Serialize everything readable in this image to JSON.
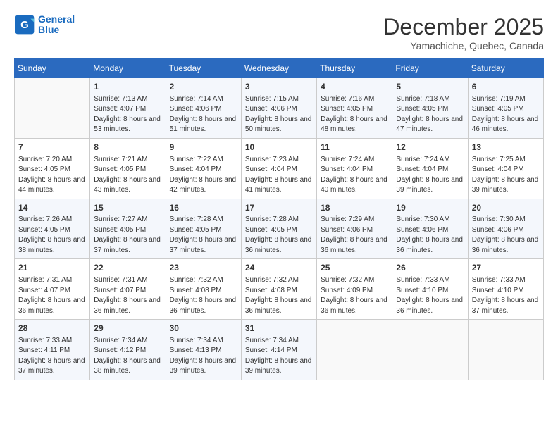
{
  "logo": {
    "line1": "General",
    "line2": "Blue"
  },
  "title": "December 2025",
  "subtitle": "Yamachiche, Quebec, Canada",
  "weekdays": [
    "Sunday",
    "Monday",
    "Tuesday",
    "Wednesday",
    "Thursday",
    "Friday",
    "Saturday"
  ],
  "weeks": [
    [
      {
        "day": "",
        "sunrise": "",
        "sunset": "",
        "daylight": ""
      },
      {
        "day": "1",
        "sunrise": "Sunrise: 7:13 AM",
        "sunset": "Sunset: 4:07 PM",
        "daylight": "Daylight: 8 hours and 53 minutes."
      },
      {
        "day": "2",
        "sunrise": "Sunrise: 7:14 AM",
        "sunset": "Sunset: 4:06 PM",
        "daylight": "Daylight: 8 hours and 51 minutes."
      },
      {
        "day": "3",
        "sunrise": "Sunrise: 7:15 AM",
        "sunset": "Sunset: 4:06 PM",
        "daylight": "Daylight: 8 hours and 50 minutes."
      },
      {
        "day": "4",
        "sunrise": "Sunrise: 7:16 AM",
        "sunset": "Sunset: 4:05 PM",
        "daylight": "Daylight: 8 hours and 48 minutes."
      },
      {
        "day": "5",
        "sunrise": "Sunrise: 7:18 AM",
        "sunset": "Sunset: 4:05 PM",
        "daylight": "Daylight: 8 hours and 47 minutes."
      },
      {
        "day": "6",
        "sunrise": "Sunrise: 7:19 AM",
        "sunset": "Sunset: 4:05 PM",
        "daylight": "Daylight: 8 hours and 46 minutes."
      }
    ],
    [
      {
        "day": "7",
        "sunrise": "Sunrise: 7:20 AM",
        "sunset": "Sunset: 4:05 PM",
        "daylight": "Daylight: 8 hours and 44 minutes."
      },
      {
        "day": "8",
        "sunrise": "Sunrise: 7:21 AM",
        "sunset": "Sunset: 4:05 PM",
        "daylight": "Daylight: 8 hours and 43 minutes."
      },
      {
        "day": "9",
        "sunrise": "Sunrise: 7:22 AM",
        "sunset": "Sunset: 4:04 PM",
        "daylight": "Daylight: 8 hours and 42 minutes."
      },
      {
        "day": "10",
        "sunrise": "Sunrise: 7:23 AM",
        "sunset": "Sunset: 4:04 PM",
        "daylight": "Daylight: 8 hours and 41 minutes."
      },
      {
        "day": "11",
        "sunrise": "Sunrise: 7:24 AM",
        "sunset": "Sunset: 4:04 PM",
        "daylight": "Daylight: 8 hours and 40 minutes."
      },
      {
        "day": "12",
        "sunrise": "Sunrise: 7:24 AM",
        "sunset": "Sunset: 4:04 PM",
        "daylight": "Daylight: 8 hours and 39 minutes."
      },
      {
        "day": "13",
        "sunrise": "Sunrise: 7:25 AM",
        "sunset": "Sunset: 4:04 PM",
        "daylight": "Daylight: 8 hours and 39 minutes."
      }
    ],
    [
      {
        "day": "14",
        "sunrise": "Sunrise: 7:26 AM",
        "sunset": "Sunset: 4:05 PM",
        "daylight": "Daylight: 8 hours and 38 minutes."
      },
      {
        "day": "15",
        "sunrise": "Sunrise: 7:27 AM",
        "sunset": "Sunset: 4:05 PM",
        "daylight": "Daylight: 8 hours and 37 minutes."
      },
      {
        "day": "16",
        "sunrise": "Sunrise: 7:28 AM",
        "sunset": "Sunset: 4:05 PM",
        "daylight": "Daylight: 8 hours and 37 minutes."
      },
      {
        "day": "17",
        "sunrise": "Sunrise: 7:28 AM",
        "sunset": "Sunset: 4:05 PM",
        "daylight": "Daylight: 8 hours and 36 minutes."
      },
      {
        "day": "18",
        "sunrise": "Sunrise: 7:29 AM",
        "sunset": "Sunset: 4:06 PM",
        "daylight": "Daylight: 8 hours and 36 minutes."
      },
      {
        "day": "19",
        "sunrise": "Sunrise: 7:30 AM",
        "sunset": "Sunset: 4:06 PM",
        "daylight": "Daylight: 8 hours and 36 minutes."
      },
      {
        "day": "20",
        "sunrise": "Sunrise: 7:30 AM",
        "sunset": "Sunset: 4:06 PM",
        "daylight": "Daylight: 8 hours and 36 minutes."
      }
    ],
    [
      {
        "day": "21",
        "sunrise": "Sunrise: 7:31 AM",
        "sunset": "Sunset: 4:07 PM",
        "daylight": "Daylight: 8 hours and 36 minutes."
      },
      {
        "day": "22",
        "sunrise": "Sunrise: 7:31 AM",
        "sunset": "Sunset: 4:07 PM",
        "daylight": "Daylight: 8 hours and 36 minutes."
      },
      {
        "day": "23",
        "sunrise": "Sunrise: 7:32 AM",
        "sunset": "Sunset: 4:08 PM",
        "daylight": "Daylight: 8 hours and 36 minutes."
      },
      {
        "day": "24",
        "sunrise": "Sunrise: 7:32 AM",
        "sunset": "Sunset: 4:08 PM",
        "daylight": "Daylight: 8 hours and 36 minutes."
      },
      {
        "day": "25",
        "sunrise": "Sunrise: 7:32 AM",
        "sunset": "Sunset: 4:09 PM",
        "daylight": "Daylight: 8 hours and 36 minutes."
      },
      {
        "day": "26",
        "sunrise": "Sunrise: 7:33 AM",
        "sunset": "Sunset: 4:10 PM",
        "daylight": "Daylight: 8 hours and 36 minutes."
      },
      {
        "day": "27",
        "sunrise": "Sunrise: 7:33 AM",
        "sunset": "Sunset: 4:10 PM",
        "daylight": "Daylight: 8 hours and 37 minutes."
      }
    ],
    [
      {
        "day": "28",
        "sunrise": "Sunrise: 7:33 AM",
        "sunset": "Sunset: 4:11 PM",
        "daylight": "Daylight: 8 hours and 37 minutes."
      },
      {
        "day": "29",
        "sunrise": "Sunrise: 7:34 AM",
        "sunset": "Sunset: 4:12 PM",
        "daylight": "Daylight: 8 hours and 38 minutes."
      },
      {
        "day": "30",
        "sunrise": "Sunrise: 7:34 AM",
        "sunset": "Sunset: 4:13 PM",
        "daylight": "Daylight: 8 hours and 39 minutes."
      },
      {
        "day": "31",
        "sunrise": "Sunrise: 7:34 AM",
        "sunset": "Sunset: 4:14 PM",
        "daylight": "Daylight: 8 hours and 39 minutes."
      },
      {
        "day": "",
        "sunrise": "",
        "sunset": "",
        "daylight": ""
      },
      {
        "day": "",
        "sunrise": "",
        "sunset": "",
        "daylight": ""
      },
      {
        "day": "",
        "sunrise": "",
        "sunset": "",
        "daylight": ""
      }
    ]
  ]
}
